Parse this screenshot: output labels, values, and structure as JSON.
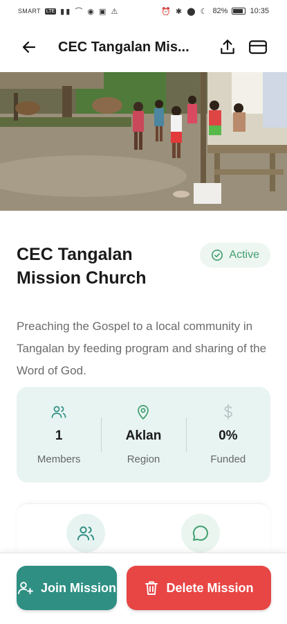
{
  "status_bar": {
    "carrier": "SMART",
    "carrier_tag": "LTE",
    "battery": "82%",
    "battery_level": 0.82,
    "time": "10:35"
  },
  "header": {
    "title": "CEC Tangalan Mis...",
    "icons": [
      "back-arrow-icon",
      "share-icon",
      "card-icon"
    ]
  },
  "mission": {
    "name": "CEC Tangalan Mission Church",
    "status": "Active",
    "description": "Preaching the Gospel to a local community in Tangalan by feeding program and sharing of the Word of God."
  },
  "stats": [
    {
      "icon": "users-icon",
      "value": "1",
      "label": "Members"
    },
    {
      "icon": "map-pin-icon",
      "value": "Aklan",
      "label": "Region"
    },
    {
      "icon": "dollar-icon",
      "value": "0%",
      "label": "Funded"
    }
  ],
  "quick_actions": [
    "members-icon",
    "chat-icon"
  ],
  "actions": {
    "join": "Join Mission",
    "delete": "Delete Mission"
  },
  "colors": {
    "accent": "#2f8f83",
    "danger": "#e84545",
    "active": "#3f9e6e",
    "stats_bg": "#e8f4f2"
  }
}
